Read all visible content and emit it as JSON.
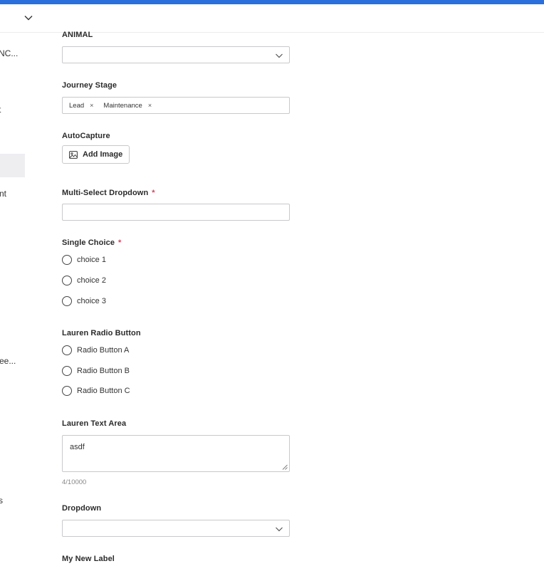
{
  "header": {
    "dropdown_icon": "chevron-down-icon"
  },
  "sidebar": {
    "items": [
      {
        "label": "NC..."
      },
      {
        "label": "t"
      },
      {
        "label": "nt"
      },
      {
        "label": "ee..."
      },
      {
        "label": "s"
      }
    ]
  },
  "form": {
    "animal": {
      "label": "ANIMAL",
      "value": ""
    },
    "journey_stage": {
      "label": "Journey Stage",
      "tags": [
        "Lead",
        "Maintenance"
      ],
      "remove_glyph": "×"
    },
    "autocapture": {
      "label": "AutoCapture",
      "button_label": "Add Image",
      "icon": "image-icon"
    },
    "multi_select": {
      "label": "Multi-Select Dropdown",
      "required_mark": "*",
      "value": ""
    },
    "single_choice": {
      "label": "Single Choice",
      "required_mark": "*",
      "options": [
        "choice 1",
        "choice 2",
        "choice 3"
      ]
    },
    "lauren_radio": {
      "label": "Lauren Radio Button",
      "options": [
        "Radio Button A",
        "Radio Button B",
        "Radio Button C"
      ]
    },
    "lauren_textarea": {
      "label": "Lauren Text Area",
      "value": "asdf",
      "counter": "4/10000"
    },
    "dropdown": {
      "label": "Dropdown",
      "value": ""
    },
    "my_new_label": {
      "label": "My New Label"
    }
  },
  "colors": {
    "accent": "#2a6fdb",
    "required": "#d9405b",
    "border": "#c9c9cc",
    "sidebar_selected": "#eeeef1"
  }
}
